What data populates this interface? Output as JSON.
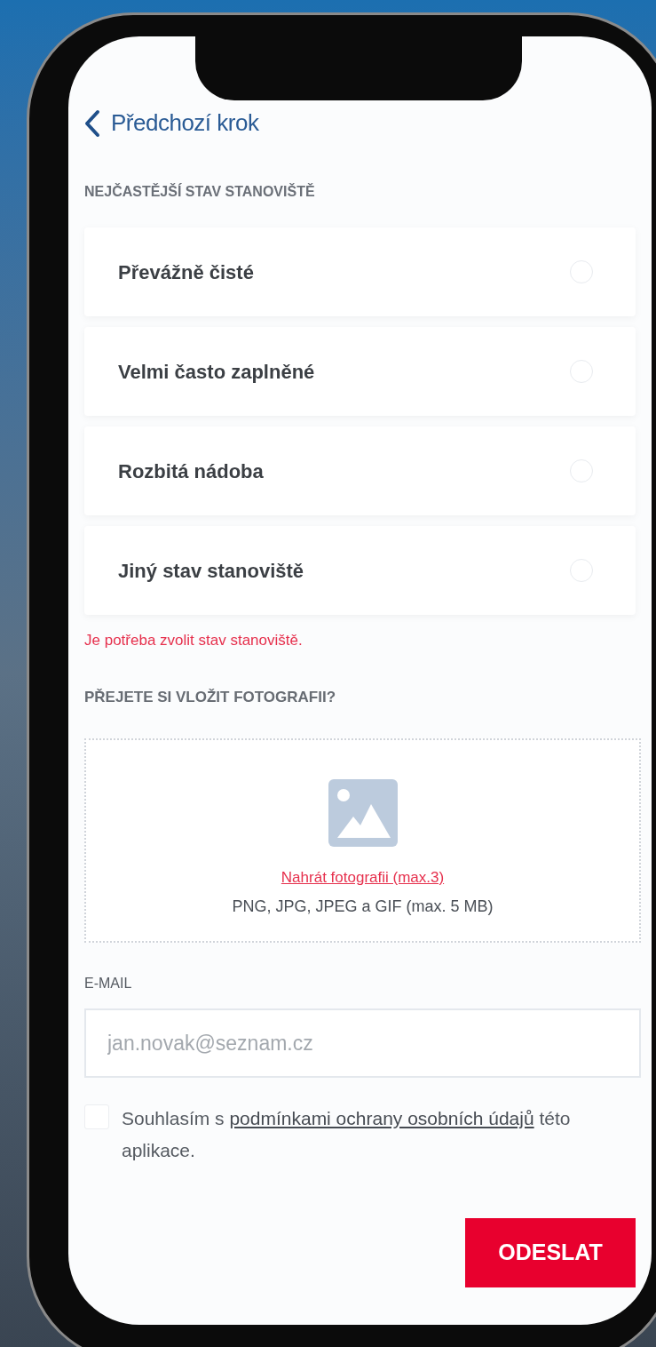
{
  "back": {
    "label": "Předchozí krok"
  },
  "state_section": {
    "title": "NEJČASTĚJŠÍ STAV STANOVIŠTĚ",
    "options": [
      {
        "label": "Převážně čisté",
        "selected": false
      },
      {
        "label": "Velmi často zaplněné",
        "selected": false
      },
      {
        "label": "Rozbitá nádoba",
        "selected": false
      },
      {
        "label": "Jiný stav stanoviště",
        "selected": false
      }
    ],
    "error": "Je potřeba zvolit stav stanoviště."
  },
  "photo_section": {
    "title": "PŘEJETE SI VLOŽIT FOTOGRAFII?",
    "upload_link": "Nahrát fotografii (max.3)",
    "hint": "PNG, JPG, JPEG a GIF (max. 5 MB)"
  },
  "email": {
    "label": "E-MAIL",
    "placeholder": "jan.novak@seznam.cz"
  },
  "consent": {
    "checked": false,
    "before": "Souhlasím s",
    "link": "podmínkami ochrany osobních údajů",
    "after": "této aplikace."
  },
  "submit": {
    "label": "ODESLAT"
  }
}
